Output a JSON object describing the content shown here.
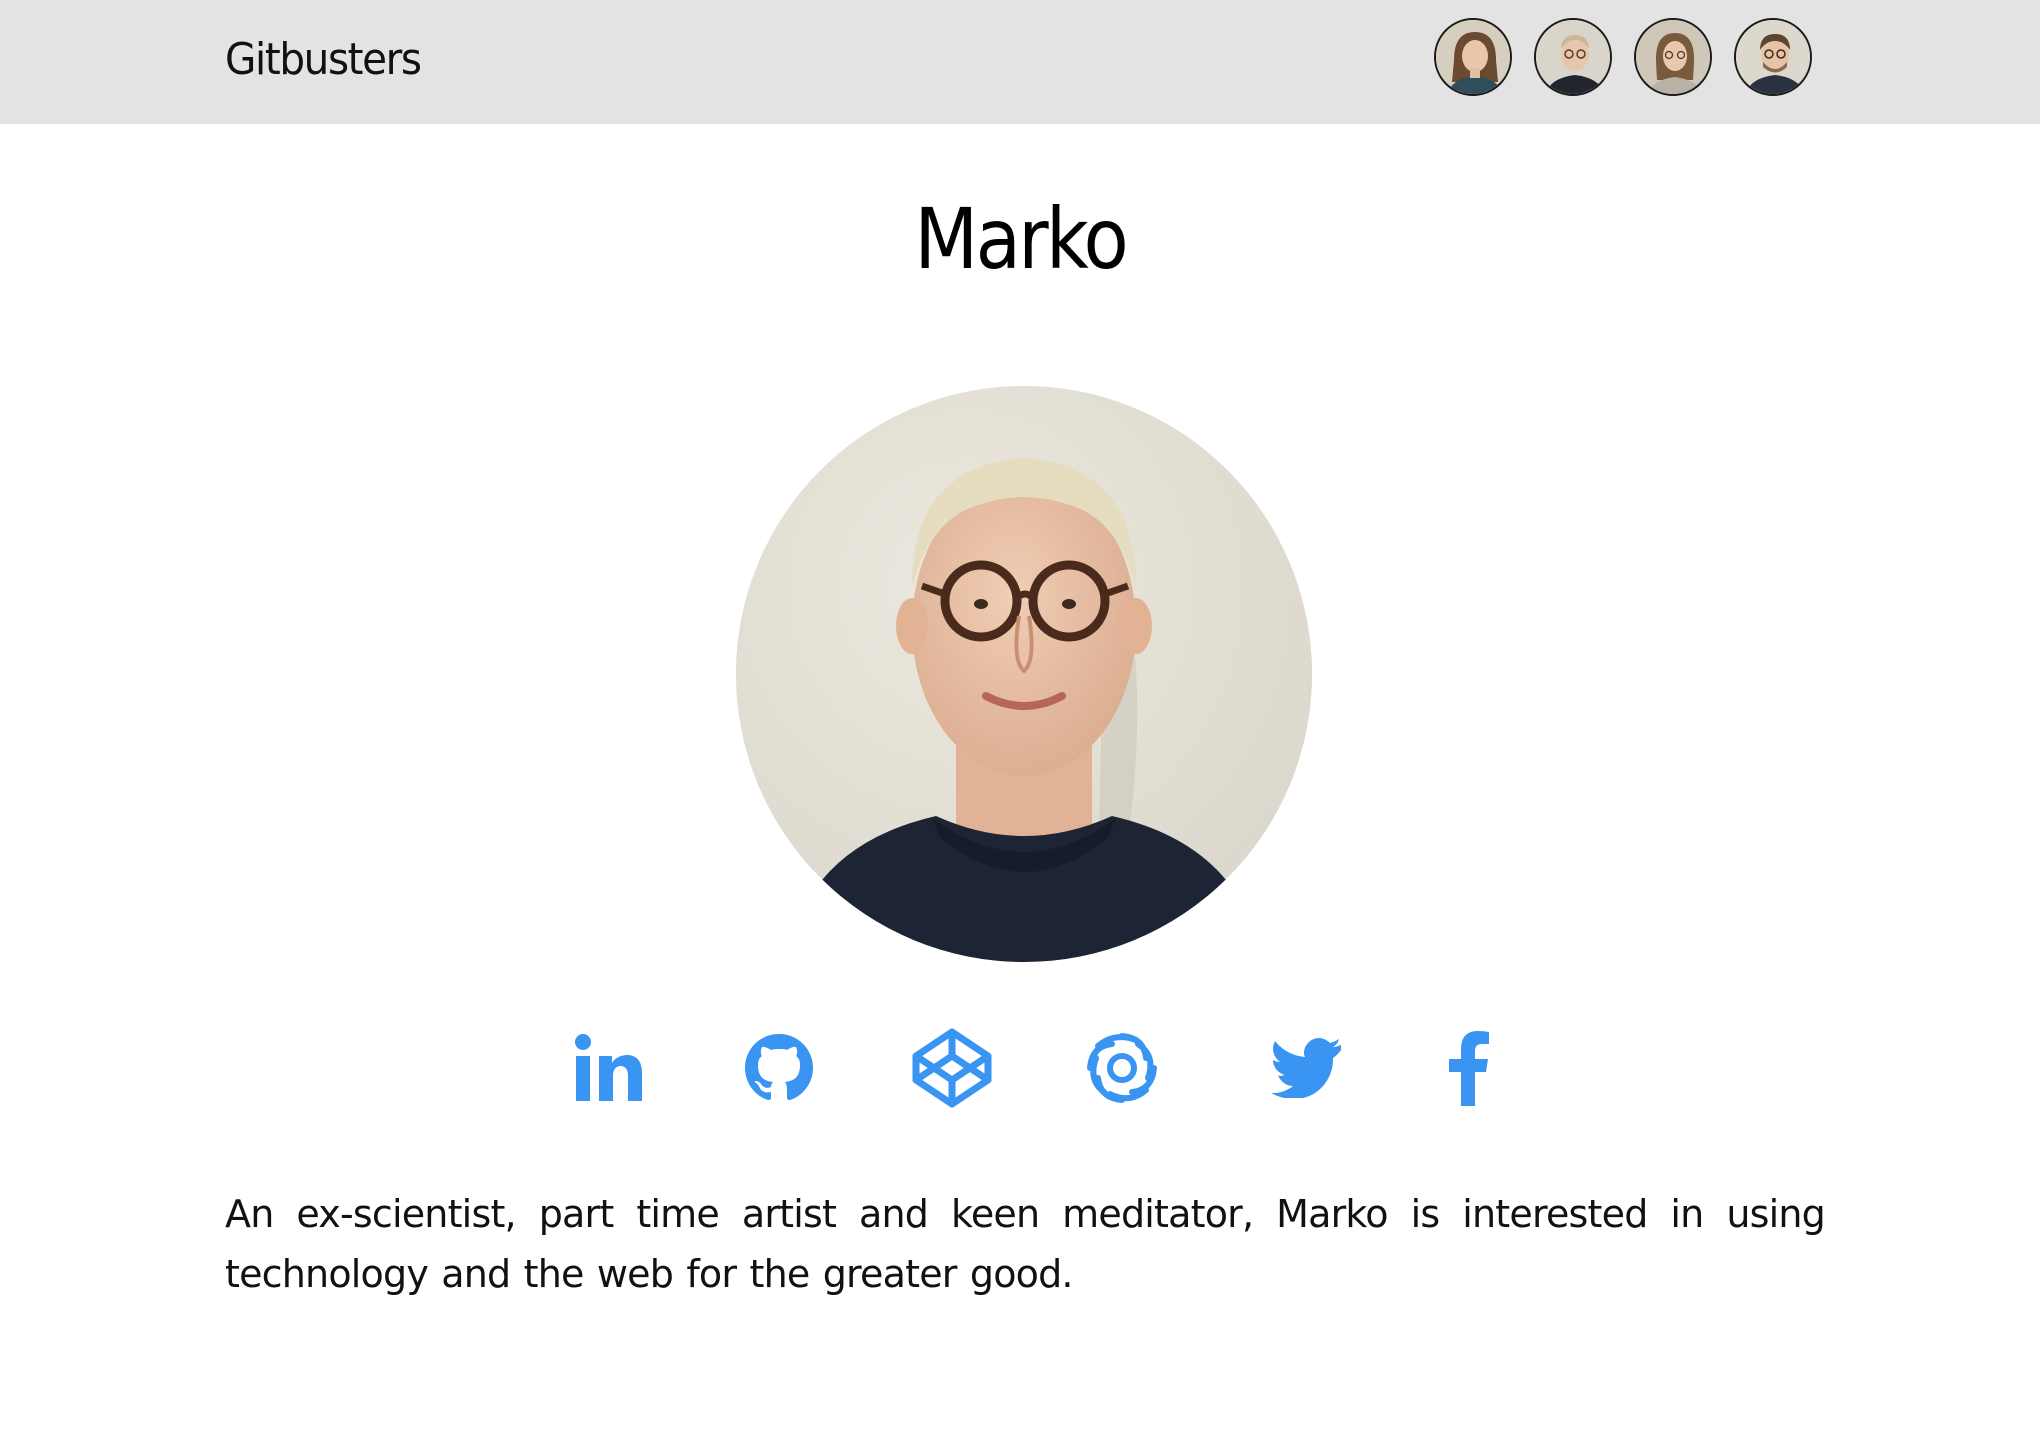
{
  "header": {
    "brand": "Gitbusters",
    "members": [
      {
        "name": "member-1",
        "hair": "#6b4a32",
        "shirt": "#2f4e5a"
      },
      {
        "name": "member-2",
        "hair": "#c9b79a",
        "shirt": "#22252e"
      },
      {
        "name": "member-3",
        "hair": "#7a5a3c",
        "shirt": "#b8b2a4"
      },
      {
        "name": "member-4",
        "hair": "#5c4630",
        "shirt": "#2a3242"
      }
    ]
  },
  "profile": {
    "name": "Marko",
    "bio": "An ex-scientist, part time artist and keen meditator, Marko is interested in using technology and the web for the greater good."
  },
  "socials": [
    {
      "icon": "linkedin-icon"
    },
    {
      "icon": "github-icon"
    },
    {
      "icon": "codepen-icon"
    },
    {
      "icon": "sololearn-icon"
    },
    {
      "icon": "twitter-icon"
    },
    {
      "icon": "facebook-icon"
    }
  ],
  "colors": {
    "header_bg": "#e3e3e3",
    "accent": "#3a95f2",
    "text": "#111111"
  }
}
